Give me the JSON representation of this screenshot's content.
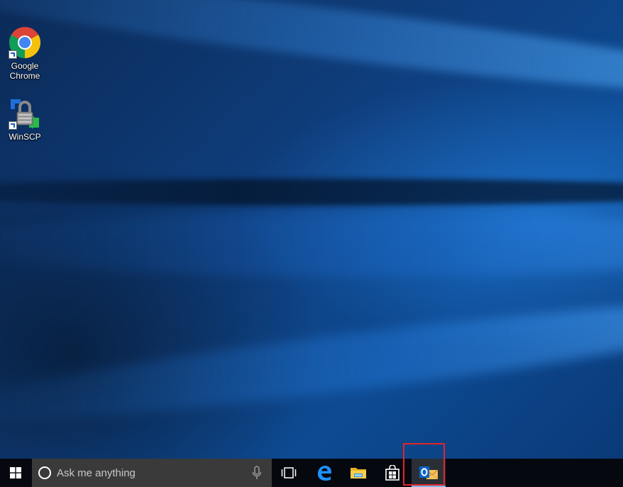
{
  "desktop": {
    "icons": [
      {
        "label": "Google\nChrome",
        "icon": "chrome-icon"
      },
      {
        "label": "WinSCP",
        "icon": "winscp-icon"
      }
    ]
  },
  "taskbar": {
    "start_icon": "windows-logo-icon",
    "search": {
      "placeholder": "Ask me anything",
      "icon": "cortana-icon",
      "mic_icon": "microphone-icon"
    },
    "pinned": [
      {
        "name": "Task View",
        "icon": "task-view-icon"
      },
      {
        "name": "Microsoft Edge",
        "icon": "edge-icon"
      },
      {
        "name": "File Explorer",
        "icon": "file-explorer-icon"
      },
      {
        "name": "Store",
        "icon": "store-icon"
      },
      {
        "name": "Outlook",
        "icon": "outlook-icon",
        "active": true,
        "highlighted": true
      }
    ]
  },
  "colors": {
    "taskbar_bg": "#05090f",
    "search_bg": "#3a3a3a",
    "highlight": "#e0252a",
    "accent": "#0078d7"
  }
}
